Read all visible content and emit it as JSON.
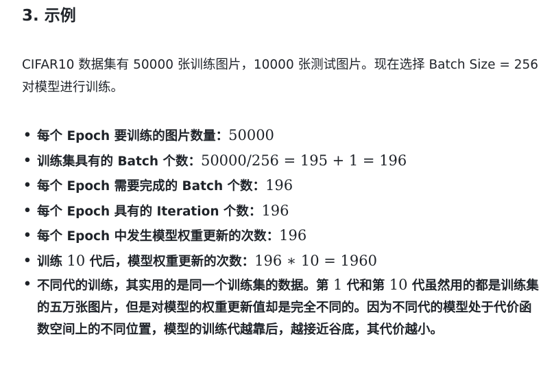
{
  "section": {
    "heading": "3. 示例"
  },
  "intro": {
    "text": "CIFAR10 数据集有 50000 张训练图片，10000 张测试图片。现在选择 Batch Size = 256 对模型进行训练。"
  },
  "bullets": [
    {
      "label": "每个 Epoch 要训练的图片数量：",
      "math": "50000"
    },
    {
      "label": "训练集具有的 Batch 个数：",
      "math": "50000/256 = 195 + 1 = 196"
    },
    {
      "label": "每个 Epoch 需要完成的 Batch 个数：",
      "math": "196"
    },
    {
      "label": "每个 Epoch 具有的 Iteration 个数：",
      "math": "196"
    },
    {
      "label": "每个 Epoch 中发生模型权重更新的次数：",
      "math": "196"
    },
    {
      "label_pre": "训练 ",
      "label_num": "10",
      "label_post": " 代后，模型权重更新的次数：",
      "math": "196 ∗ 10 = 1960"
    },
    {
      "part1": "不同代的训练，其实用的是同一个训练集的数据。第 ",
      "num1": "1",
      "part2": " 代和第 ",
      "num2": "10",
      "part3": " 代虽然用的都是训练集的五万张图片，但是对模型的权重更新值却是完全不同的。因为不同代的模型处于代价函数空间上的不同位置，模型的训练代越靠后，越接近谷底，其代价越小。"
    }
  ],
  "bullet_glyph": "•"
}
